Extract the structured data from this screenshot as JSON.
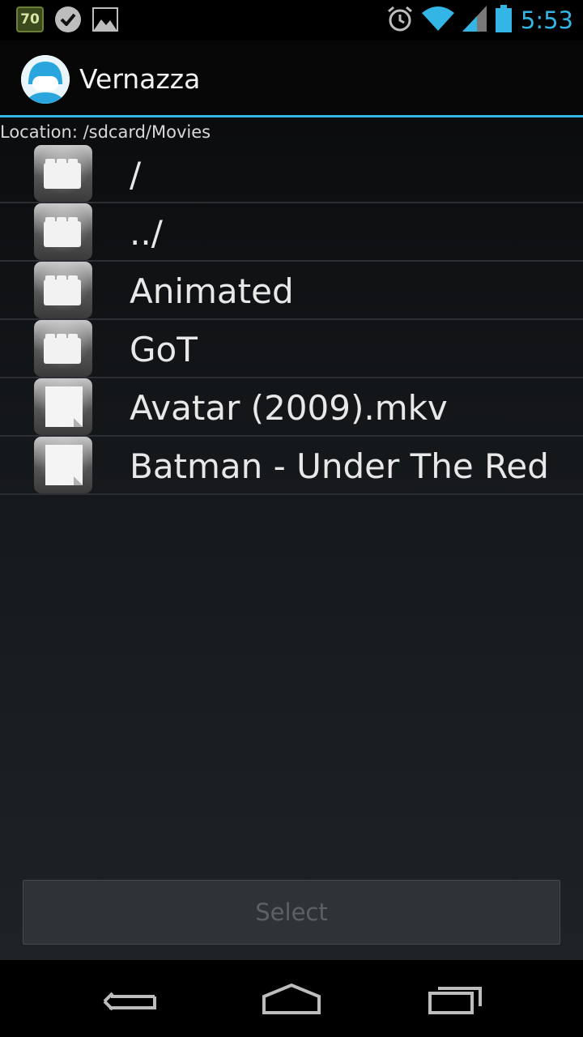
{
  "status_bar": {
    "battery_badge": "70",
    "time": "5:53",
    "icons": [
      "battery-percent-icon",
      "checkmark-icon",
      "image-icon",
      "alarm-icon",
      "wifi-icon",
      "signal-icon",
      "battery-icon"
    ]
  },
  "action_bar": {
    "title": "Vernazza",
    "accent_color": "#33b5e5"
  },
  "location": "Location: /sdcard/Movies",
  "files": [
    {
      "name": "/",
      "type": "folder"
    },
    {
      "name": "../",
      "type": "folder"
    },
    {
      "name": "Animated",
      "type": "folder"
    },
    {
      "name": "GoT",
      "type": "folder"
    },
    {
      "name": "Avatar (2009).mkv",
      "type": "file"
    },
    {
      "name": "Batman - Under The Red",
      "type": "file"
    }
  ],
  "select_button": "Select",
  "nav": [
    "back-icon",
    "home-icon",
    "recents-icon"
  ]
}
